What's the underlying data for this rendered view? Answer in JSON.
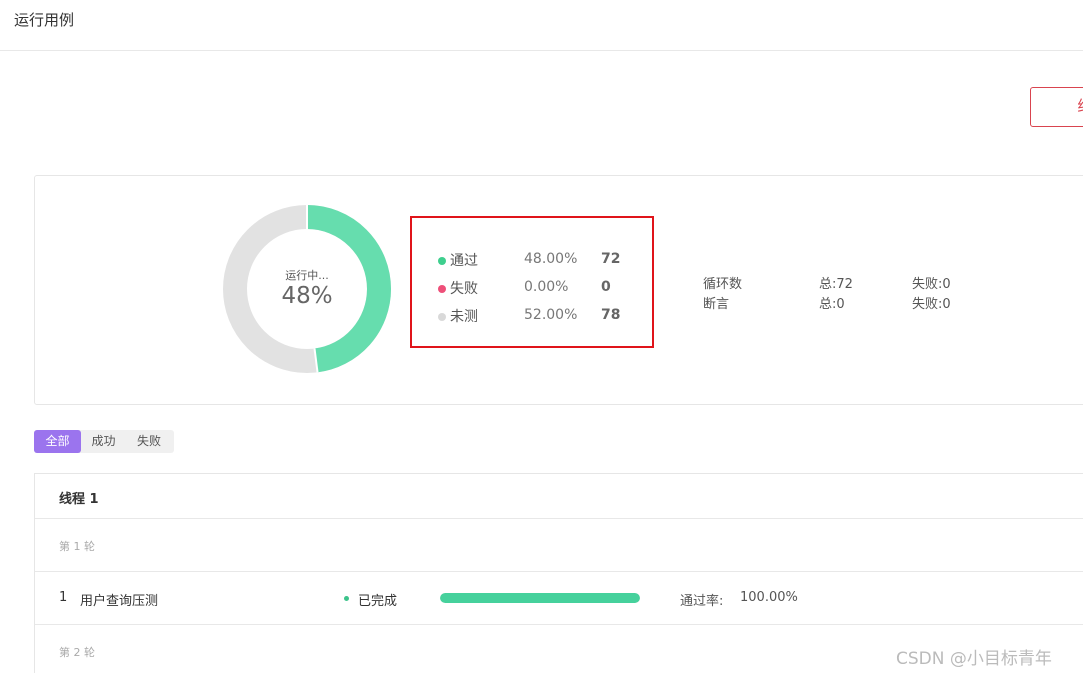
{
  "header": {
    "title": "运行用例"
  },
  "actions": {
    "terminate_label": "终"
  },
  "summary": {
    "status_text": "运行中...",
    "percent_text": "48%",
    "pass_ratio": 0.48,
    "colors": {
      "pass": "#66ddae",
      "fail": "#ee4f79",
      "untested": "#e2e2e2"
    },
    "legend": [
      {
        "label": "通过",
        "percent": "48.00%",
        "count": "72",
        "color": "#3ecf8e"
      },
      {
        "label": "失败",
        "percent": "0.00%",
        "count": "0",
        "color": "#ee4f79"
      },
      {
        "label": "未测",
        "percent": "52.00%",
        "count": "78",
        "color": "#d9d9d9"
      }
    ],
    "metrics": [
      {
        "name": "循环数",
        "total": "总:72",
        "failed": "失败:0"
      },
      {
        "name": "断言",
        "total": "总:0",
        "failed": "失败:0"
      }
    ]
  },
  "filters": [
    {
      "label": "全部",
      "active": true
    },
    {
      "label": "成功",
      "active": false
    },
    {
      "label": "失败",
      "active": false
    }
  ],
  "thread": {
    "title": "线程 1",
    "rounds": [
      {
        "label": "第 1 轮"
      },
      {
        "label": "第 2 轮"
      }
    ],
    "cases": [
      {
        "index": "1",
        "name": "用户查询压测",
        "status": "已完成",
        "progress": 1.0,
        "pass_rate_label": "通过率:",
        "pass_rate_value": "100.00%"
      }
    ]
  },
  "watermark": "CSDN @小目标青年"
}
